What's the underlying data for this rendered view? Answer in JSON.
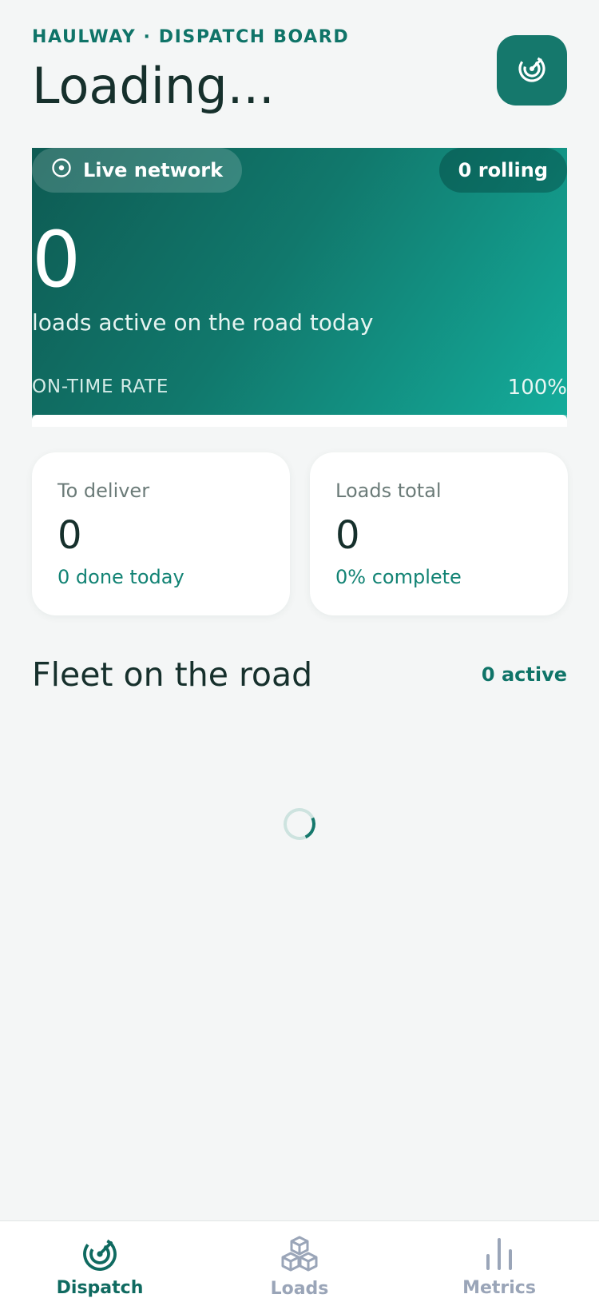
{
  "header": {
    "eyebrow": "HAULWAY · DISPATCH BOARD",
    "title": "Loading..."
  },
  "hero": {
    "live_label": "Live network",
    "rolling_badge": "0 rolling",
    "active_count": "0",
    "active_caption": "loads active on the road today",
    "on_time_label": "ON-TIME RATE",
    "on_time_value": "100%",
    "on_time_fraction": 1.0
  },
  "stats": [
    {
      "label": "To deliver",
      "value": "0",
      "note": "0 done today"
    },
    {
      "label": "Loads total",
      "value": "0",
      "note": "0% complete"
    }
  ],
  "fleet": {
    "title": "Fleet on the road",
    "active_meta": "0 active"
  },
  "nav": {
    "items": [
      {
        "label": "Dispatch",
        "icon": "radar-icon",
        "active": true
      },
      {
        "label": "Loads",
        "icon": "boxes-icon",
        "active": false
      },
      {
        "label": "Metrics",
        "icon": "bar-chart-icon",
        "active": false
      }
    ]
  },
  "colors": {
    "brand": "#15786c",
    "accent_text": "#0f7468",
    "background": "#f4f6f6",
    "nav_inactive": "#9aa5b8"
  }
}
